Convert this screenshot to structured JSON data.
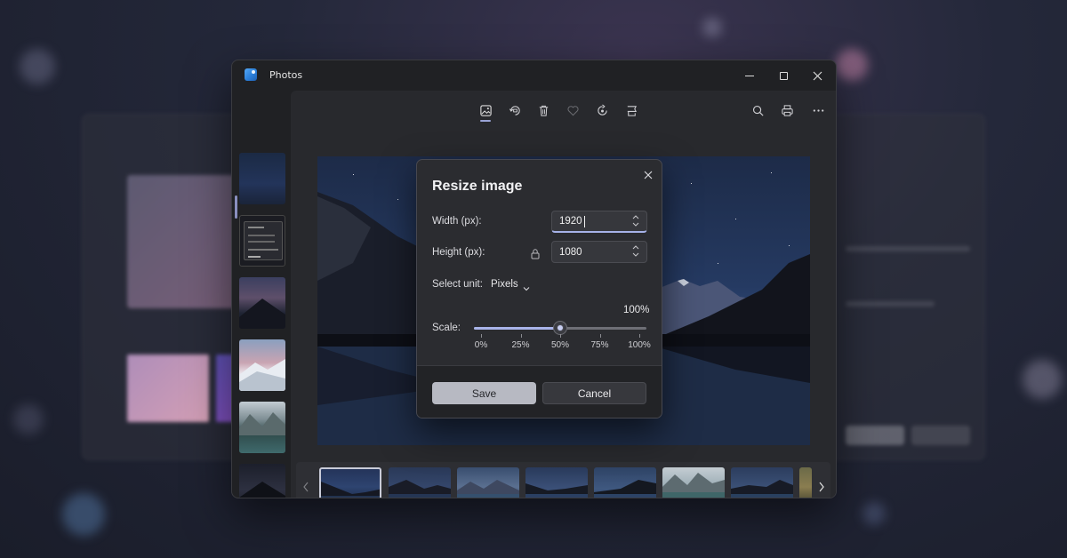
{
  "window": {
    "app_title": "Photos",
    "controls": [
      "minimize-icon",
      "maximize-icon",
      "close-icon"
    ]
  },
  "toolbar": {
    "center_icons": [
      "image-view-icon",
      "rotate-icon",
      "delete-icon",
      "favorite-icon",
      "edit-icon",
      "crop-icon"
    ],
    "right_icons": [
      "search-icon",
      "print-icon",
      "more-icon"
    ]
  },
  "dialog": {
    "title": "Resize image",
    "width_label": "Width (px):",
    "width_value": "1920",
    "height_label": "Height (px):",
    "height_value": "1080",
    "unit_label": "Select unit:",
    "unit_value": "Pixels",
    "scale_label": "Scale:",
    "scale_value": "100%",
    "scale_level": 0.5,
    "scale_ticks": [
      "0%",
      "25%",
      "50%",
      "75%",
      "100%"
    ],
    "save_label": "Save",
    "cancel_label": "Cancel"
  },
  "colors": {
    "accent": "#a9b4e9",
    "window_bg": "#202124",
    "dialog_bg": "#2b2c30"
  }
}
